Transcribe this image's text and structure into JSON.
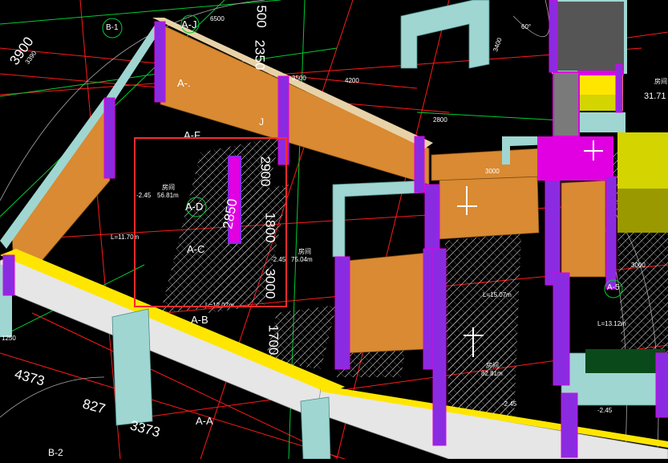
{
  "colors": {
    "background": "#000000",
    "wall_orange": "#d98a32",
    "wall_purple": "#8a2be2",
    "wall_magenta": "#e100e1",
    "wall_cyan": "#9fd6d2",
    "wall_yellow": "#ffe600",
    "slab_white": "#e6e6e6",
    "grid_red": "#ff1a1a",
    "grid_green": "#00cc33",
    "selection_red": "#ff2a2a",
    "text": "#ffffff"
  },
  "axis_labels": {
    "a_j": "A-J",
    "a_f": "A-F",
    "a_d": "A-D",
    "a_c": "A-C",
    "a_b": "A-B",
    "a_a": "A-A",
    "a_5": "A-5",
    "b_1": "B-1",
    "b_2": "B-2",
    "j": "J",
    "a_dot": "A-."
  },
  "dimensions": {
    "d3900": "3900",
    "d6500": "6500",
    "d500": "500",
    "d2350": "2350",
    "d3500": "3500",
    "d4200": "4200",
    "d2800": "2800",
    "d3000_top": "3000",
    "d2900": "2900",
    "d2850": "2850",
    "d1800": "1800",
    "d3000": "3000",
    "d1700": "1700",
    "d4373": "4373",
    "d827": "827",
    "d3373": "3373",
    "d3000_right": "3000",
    "d3400": "3400",
    "d60deg": "60°",
    "d3390": "3390",
    "d1250": "1250"
  },
  "annotations": {
    "room_label_1": "房间",
    "area_1": "56.81m",
    "room_label_2": "房间",
    "area_2": "75.04m",
    "room_label_3": "房间",
    "area_3": "82.81m",
    "len_1": "L=11.70m",
    "len_2": "L=12.07m",
    "len_3": "L=15.07m",
    "len_4": "L=13.12m",
    "level_1": "-2.45",
    "level_2": "-2.45",
    "level_3": "-2.45",
    "level_4": "-2.45",
    "right_num": "31.71",
    "right_label": "房间"
  }
}
